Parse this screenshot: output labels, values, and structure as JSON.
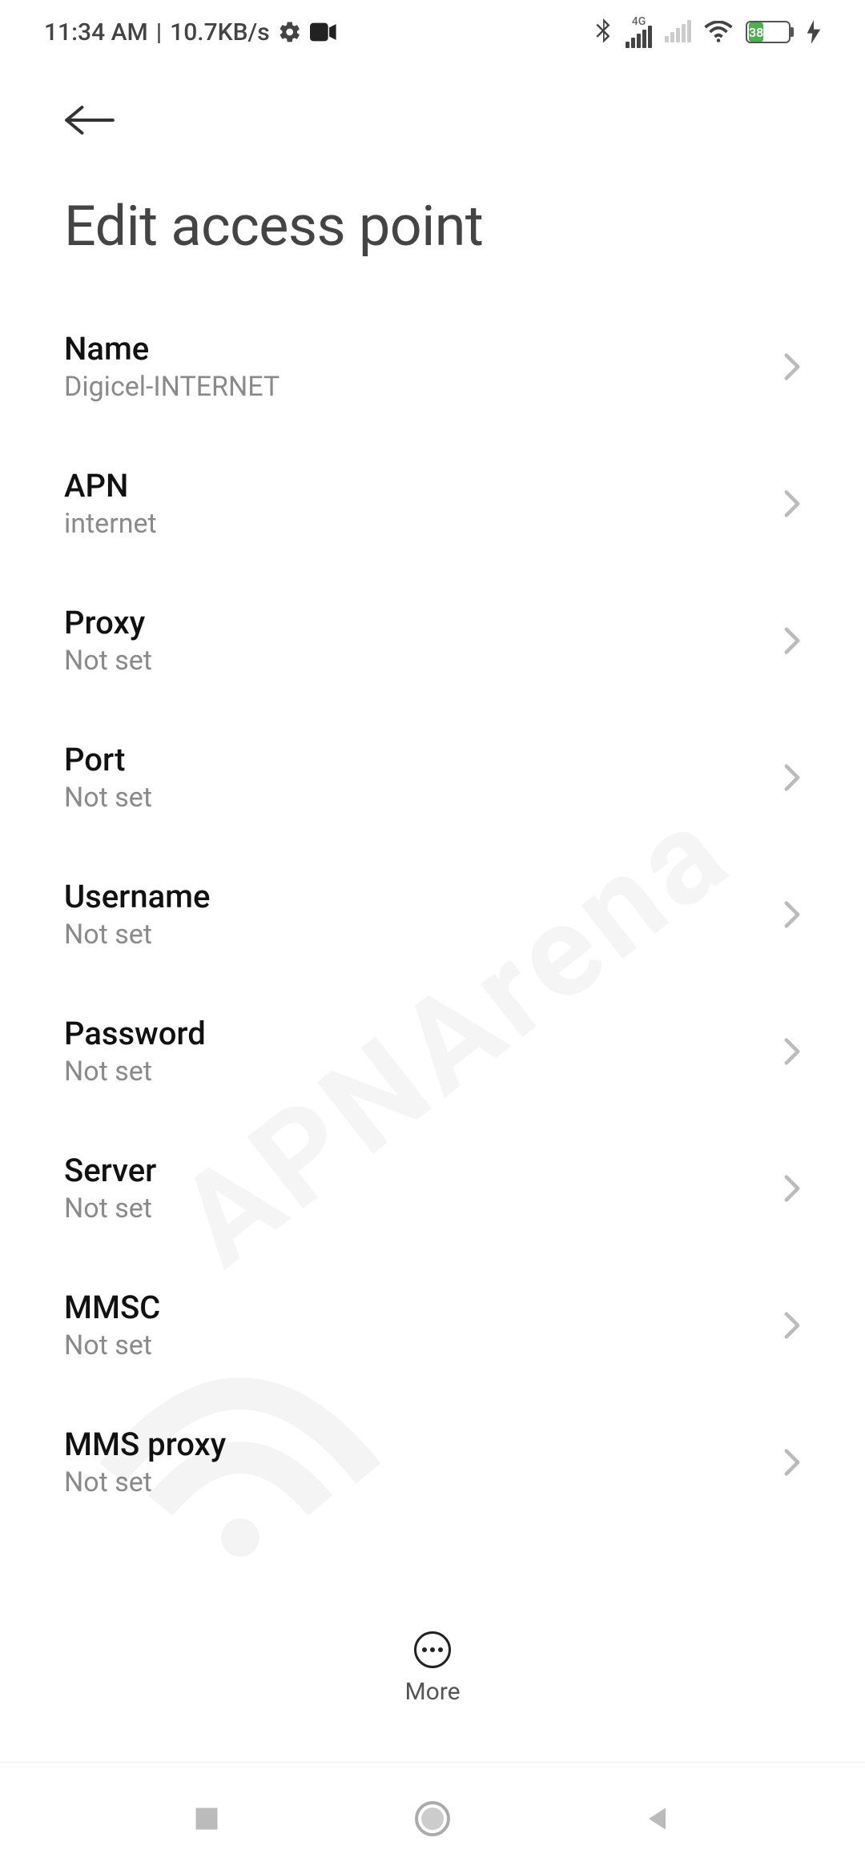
{
  "status": {
    "time": "11:34 AM",
    "separator": "|",
    "net_speed": "10.7KB/s",
    "cell_label": "4G",
    "battery_percent": "38"
  },
  "header": {
    "title": "Edit access point"
  },
  "settings": [
    {
      "label": "Name",
      "value": "Digicel-INTERNET"
    },
    {
      "label": "APN",
      "value": "internet"
    },
    {
      "label": "Proxy",
      "value": "Not set"
    },
    {
      "label": "Port",
      "value": "Not set"
    },
    {
      "label": "Username",
      "value": "Not set"
    },
    {
      "label": "Password",
      "value": "Not set"
    },
    {
      "label": "Server",
      "value": "Not set"
    },
    {
      "label": "MMSC",
      "value": "Not set"
    },
    {
      "label": "MMS proxy",
      "value": "Not set"
    }
  ],
  "bottom": {
    "more_label": "More"
  },
  "watermark": "APNArena"
}
